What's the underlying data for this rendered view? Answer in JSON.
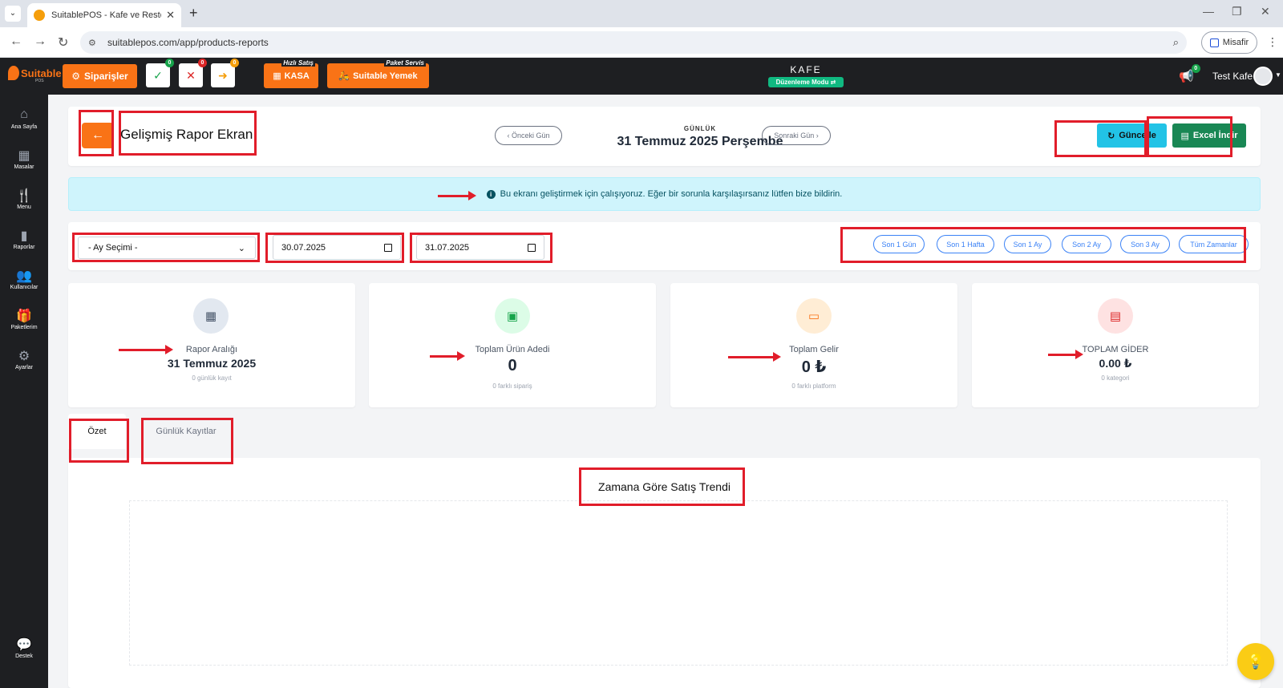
{
  "browser": {
    "tab_title": "SuitablePOS - Kafe ve Restoran",
    "url": "suitablepos.com/app/products-reports",
    "guest_label": "Misafir"
  },
  "appbar": {
    "logo_text": "Suitable",
    "logo_sub": "POS",
    "orders_label": "Siparişler",
    "badge_done": "0",
    "badge_cancel": "0",
    "badge_transfer": "0",
    "kasa_tag": "Hızlı Satış",
    "kasa_label": "KASA",
    "yemek_tag": "Paket Servis",
    "yemek_label": "Suitable Yemek",
    "venue": "KAFE",
    "edit_mode": "Düzenleme Modu ⇄",
    "notif_count": "0",
    "user_name": "Test Kafe"
  },
  "sidebar": {
    "items": [
      {
        "label": "Ana Sayfa",
        "icon": "home-icon"
      },
      {
        "label": "Masalar",
        "icon": "table-icon"
      },
      {
        "label": "Menu",
        "icon": "menu-icon"
      },
      {
        "label": "Raporlar",
        "icon": "reports-icon"
      },
      {
        "label": "Kullanıcılar",
        "icon": "users-icon"
      },
      {
        "label": "Paketlerim",
        "icon": "gift-icon"
      },
      {
        "label": "Ayarlar",
        "icon": "settings-icon"
      },
      {
        "label": "Destek",
        "icon": "support-icon"
      }
    ]
  },
  "header": {
    "title": "Gelişmiş Rapor Ekranı",
    "prev_day": "Önceki Gün",
    "next_day": "Sonraki Gün",
    "period": "GÜNLÜK",
    "date": "31 Temmuz 2025 Perşembe",
    "refresh": "Güncelle",
    "excel": "Excel İndir"
  },
  "info": {
    "message": "Bu ekranı geliştirmek için çalışıyoruz. Eğer bir sorunla karşılaşırsanız lütfen bize bildirin."
  },
  "filters": {
    "month_select": "- Ay Seçimi -",
    "start_date": "30.07.2025",
    "end_date": "31.07.2025",
    "ranges": [
      "Son 1 Gün",
      "Son 1 Hafta",
      "Son 1 Ay",
      "Son 2 Ay",
      "Son 3 Ay",
      "Tüm Zamanlar"
    ]
  },
  "stats": [
    {
      "label": "Rapor Aralığı",
      "value": "31 Temmuz 2025",
      "sub": "0 günlük kayıt",
      "icon": "calendar-icon",
      "color": "#475569"
    },
    {
      "label": "Toplam Ürün Adedi",
      "value": "0",
      "sub": "0 farklı sipariş",
      "icon": "boxes-icon",
      "color": "#16a34a"
    },
    {
      "label": "Toplam Gelir",
      "value": "0 ₺",
      "sub": "0 farklı platform",
      "icon": "money-icon",
      "color": "#f97316"
    },
    {
      "label": "TOPLAM GİDER",
      "value": "0.00 ₺",
      "sub": "0 kategori",
      "icon": "receipt-icon",
      "color": "#dc2626"
    }
  ],
  "tabs": {
    "summary": "Özet",
    "daily": "Günlük Kayıtlar"
  },
  "chart": {
    "title": "Zamana Göre Satış Trendi"
  }
}
